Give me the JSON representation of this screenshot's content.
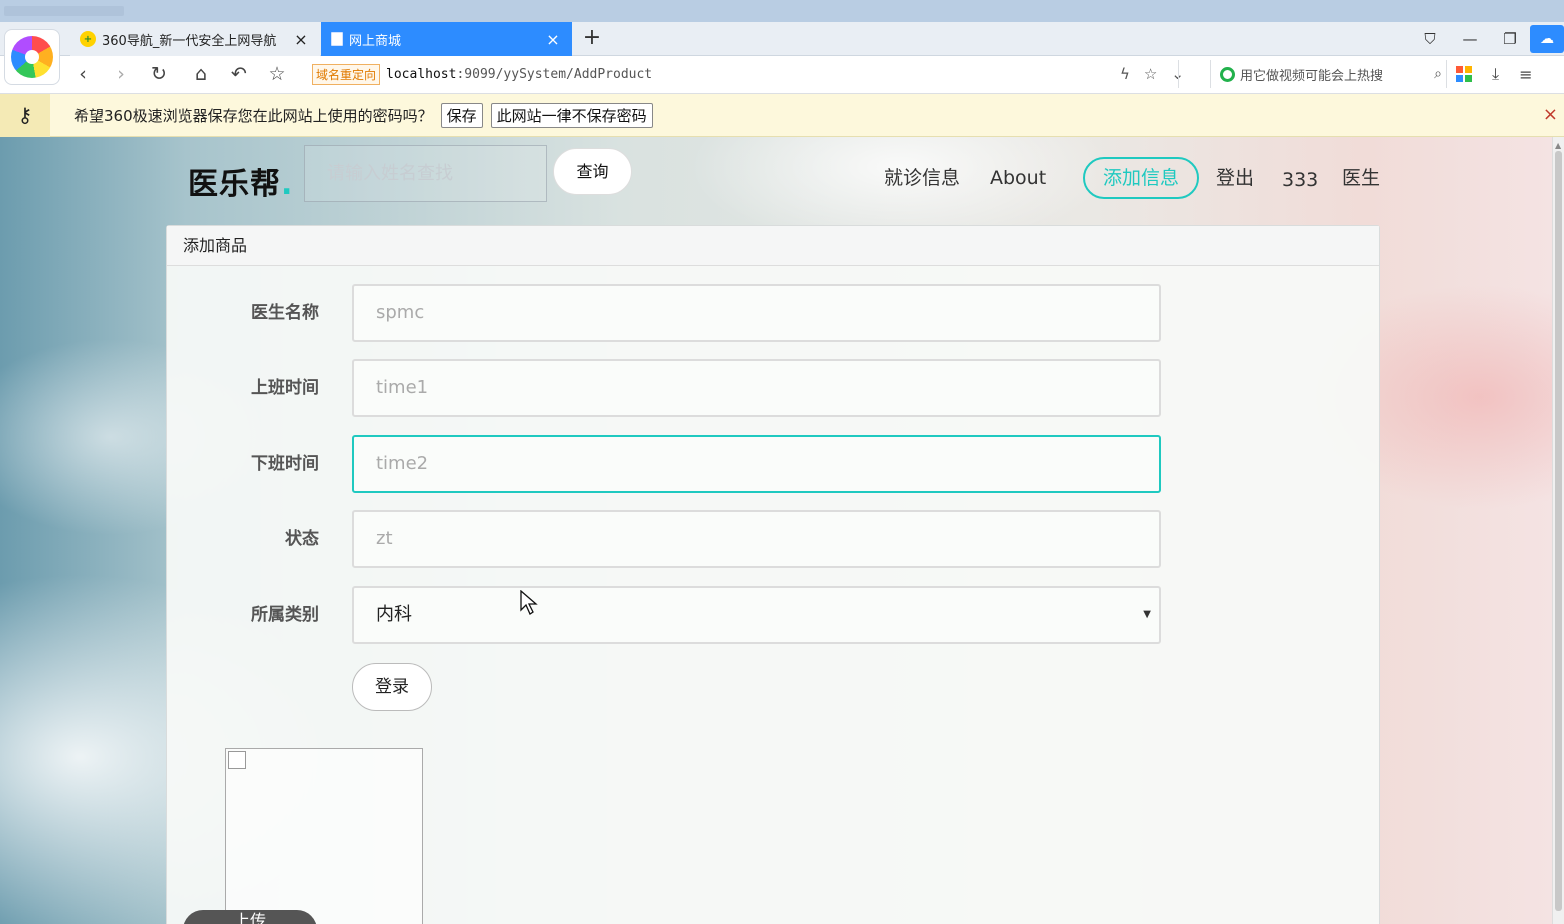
{
  "browser": {
    "tabs": [
      {
        "title": "360导航_新一代安全上网导航",
        "close": "×"
      },
      {
        "title": "网上商城",
        "close": "×"
      }
    ],
    "new_tab": "+",
    "address": {
      "redirect_label": "域名重定向",
      "host": "localhost",
      "path": ":9099/yySystem/AddProduct"
    },
    "search_placeholder": "用它做视频可能会上热搜"
  },
  "password_bar": {
    "message": "希望360极速浏览器保存您在此网站上使用的密码吗？",
    "save_label": "保存",
    "never_label": "此网站一律不保存密码",
    "close": "×"
  },
  "site": {
    "brand": "医乐帮",
    "brand_dot": ".",
    "search_placeholder": "请输入姓名查找",
    "query_label": "查询",
    "nav": {
      "visit_info": "就诊信息",
      "about": "About",
      "add_info": "添加信息",
      "logout": "登出",
      "user": "333",
      "role": "医生"
    }
  },
  "form": {
    "panel_title": "添加商品",
    "fields": [
      {
        "label": "医生名称",
        "placeholder": "spmc"
      },
      {
        "label": "上班时间",
        "placeholder": "time1"
      },
      {
        "label": "下班时间",
        "placeholder": "time2"
      },
      {
        "label": "状态",
        "placeholder": "zt"
      }
    ],
    "category": {
      "label": "所属类别",
      "selected": "内科"
    },
    "submit_label": "登录",
    "upload_label": "上传"
  },
  "colors": {
    "accent": "#1fc9c0",
    "tab_active": "#2d8cff"
  }
}
